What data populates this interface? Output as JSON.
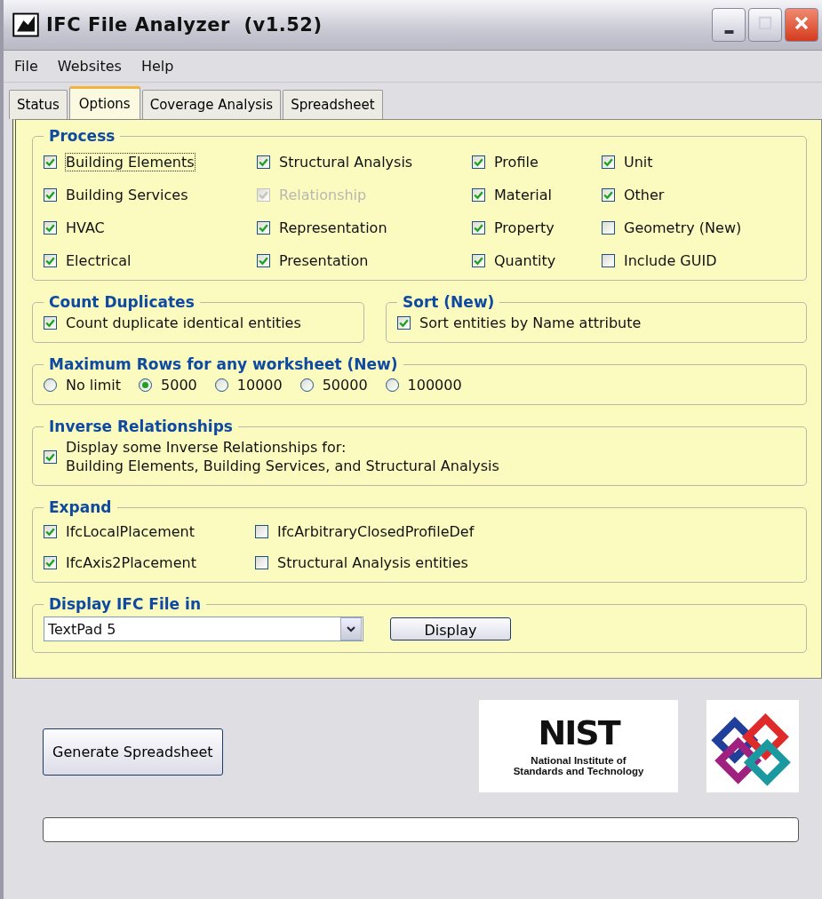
{
  "window": {
    "title": "IFC File Analyzer  (v1.52)"
  },
  "menu": [
    "File",
    "Websites",
    "Help"
  ],
  "tabs": [
    {
      "label": "Status",
      "selected": false
    },
    {
      "label": "Options",
      "selected": true
    },
    {
      "label": "Coverage Analysis",
      "selected": false
    },
    {
      "label": "Spreadsheet",
      "selected": false
    }
  ],
  "process": {
    "title": "Process",
    "items": [
      {
        "label": "Building Elements",
        "checked": true,
        "disabled": false,
        "focused": true
      },
      {
        "label": "Structural Analysis",
        "checked": true,
        "disabled": false,
        "focused": false
      },
      {
        "label": "Profile",
        "checked": true,
        "disabled": false,
        "focused": false
      },
      {
        "label": "Unit",
        "checked": true,
        "disabled": false,
        "focused": false
      },
      {
        "label": "Building Services",
        "checked": true,
        "disabled": false,
        "focused": false
      },
      {
        "label": "Relationship",
        "checked": true,
        "disabled": true,
        "focused": false
      },
      {
        "label": "Material",
        "checked": true,
        "disabled": false,
        "focused": false
      },
      {
        "label": "Other",
        "checked": true,
        "disabled": false,
        "focused": false
      },
      {
        "label": "HVAC",
        "checked": true,
        "disabled": false,
        "focused": false
      },
      {
        "label": "Representation",
        "checked": true,
        "disabled": false,
        "focused": false
      },
      {
        "label": "Property",
        "checked": true,
        "disabled": false,
        "focused": false
      },
      {
        "label": "Geometry (New)",
        "checked": false,
        "disabled": false,
        "focused": false
      },
      {
        "label": "Electrical",
        "checked": true,
        "disabled": false,
        "focused": false
      },
      {
        "label": "Presentation",
        "checked": true,
        "disabled": false,
        "focused": false
      },
      {
        "label": "Quantity",
        "checked": true,
        "disabled": false,
        "focused": false
      },
      {
        "label": "Include GUID",
        "checked": false,
        "disabled": false,
        "focused": false
      }
    ]
  },
  "count_duplicates": {
    "title": "Count Duplicates",
    "items": [
      {
        "label": "Count duplicate identical entities",
        "checked": true
      }
    ]
  },
  "sort": {
    "title": "Sort (New)",
    "items": [
      {
        "label": "Sort entities by Name attribute",
        "checked": true
      }
    ]
  },
  "maximum_rows": {
    "title": "Maximum Rows for any worksheet (New)",
    "options": [
      {
        "label": "No limit",
        "selected": false
      },
      {
        "label": "5000",
        "selected": true
      },
      {
        "label": "10000",
        "selected": false
      },
      {
        "label": "50000",
        "selected": false
      },
      {
        "label": "100000",
        "selected": false
      }
    ]
  },
  "inverse_relationships": {
    "title": "Inverse Relationships",
    "items": [
      {
        "label": "Display some Inverse Relationships for:",
        "detail": "Building Elements, Building Services, and Structural Analysis",
        "checked": true
      }
    ]
  },
  "expand": {
    "title": "Expand",
    "items": [
      {
        "label": "IfcLocalPlacement",
        "checked": true
      },
      {
        "label": "IfcArbitraryClosedProfileDef",
        "checked": false
      },
      {
        "label": "IfcAxis2Placement",
        "checked": true
      },
      {
        "label": "Structural Analysis entities",
        "checked": false
      }
    ]
  },
  "display_ifc_file": {
    "title": "Display IFC File in",
    "value": "TextPad 5",
    "button": "Display"
  },
  "generate_button": "Generate Spreadsheet",
  "nist_logo": {
    "mark": "NIST",
    "line_1": "National Institute of",
    "line_2": "Standards and Technology"
  }
}
